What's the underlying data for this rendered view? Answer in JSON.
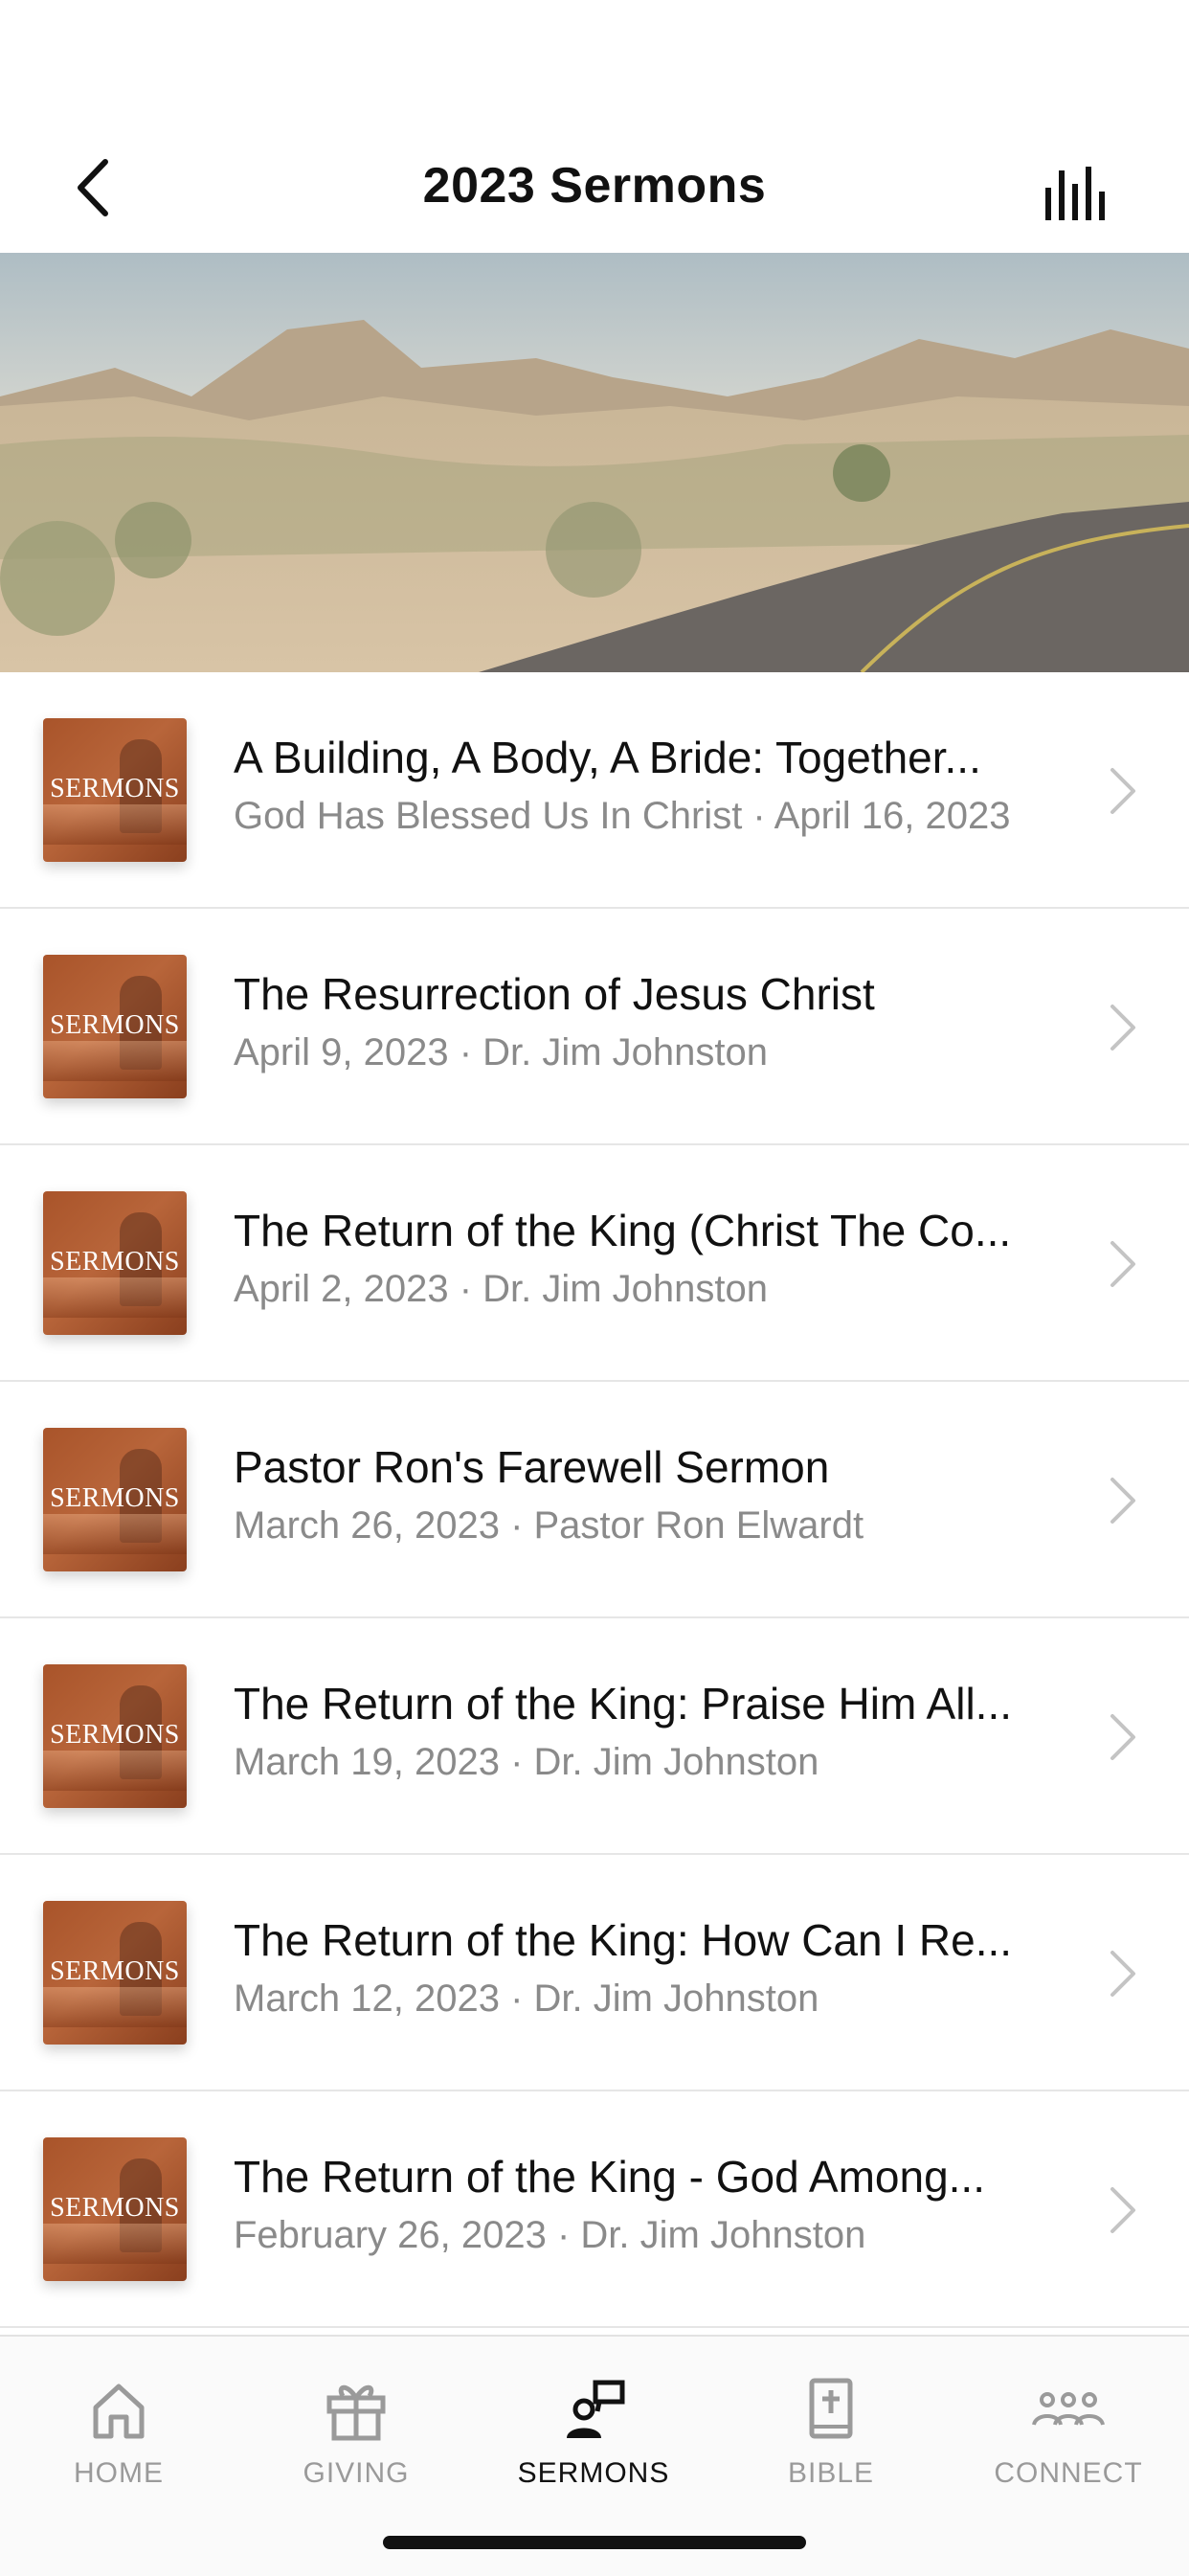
{
  "header": {
    "title": "2023 Sermons",
    "back_icon": "chevron-left-icon",
    "right_icon": "bars-icon"
  },
  "banner": {
    "alt": "desert-road-image"
  },
  "thumbnail_label": "SERMONS",
  "sermons": [
    {
      "title": "A Building, A Body, A Bride: Together...",
      "subtitle": "God Has Blessed Us In Christ · April 16, 2023"
    },
    {
      "title": "The Resurrection of Jesus Christ",
      "subtitle": "April 9, 2023 · Dr. Jim Johnston"
    },
    {
      "title": "The Return of the King (Christ The Co...",
      "subtitle": "April 2, 2023 · Dr. Jim Johnston"
    },
    {
      "title": "Pastor Ron's Farewell Sermon",
      "subtitle": "March 26, 2023 · Pastor Ron Elwardt"
    },
    {
      "title": "The Return of the King: Praise Him All...",
      "subtitle": "March 19, 2023 · Dr. Jim Johnston"
    },
    {
      "title": "The Return of the King: How Can I Re...",
      "subtitle": "March 12, 2023 · Dr. Jim Johnston"
    },
    {
      "title": "The Return of the King - God Among...",
      "subtitle": "February 26, 2023 · Dr. Jim Johnston"
    }
  ],
  "tabs": [
    {
      "label": "HOME",
      "icon": "home-icon",
      "active": false
    },
    {
      "label": "GIVING",
      "icon": "gift-icon",
      "active": false
    },
    {
      "label": "SERMONS",
      "icon": "sermons-icon",
      "active": true
    },
    {
      "label": "BIBLE",
      "icon": "bible-icon",
      "active": false
    },
    {
      "label": "CONNECT",
      "icon": "people-icon",
      "active": false
    }
  ],
  "colors": {
    "text_primary": "#111111",
    "text_secondary": "#8a8a8a",
    "thumbnail": "#a9542a",
    "tab_inactive": "#9a9a9a"
  }
}
